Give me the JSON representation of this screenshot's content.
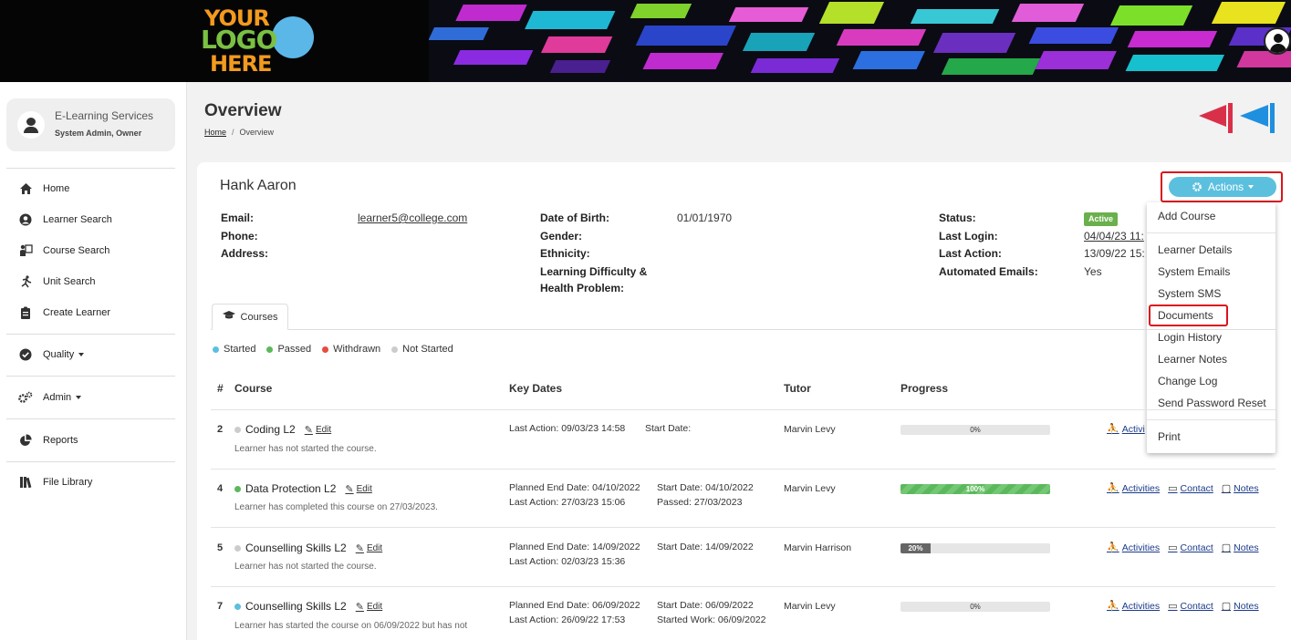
{
  "logo": {
    "line1": "YOUR",
    "line2": "LOGO",
    "line3": "HERE"
  },
  "sidebar": {
    "user": {
      "name": "E-Learning Services",
      "role": "System Admin, Owner"
    },
    "items": [
      {
        "label": "Home",
        "icon": "home-icon"
      },
      {
        "label": "Learner Search",
        "icon": "user-circle-icon"
      },
      {
        "label": "Course Search",
        "icon": "chalkboard-icon"
      },
      {
        "label": "Unit Search",
        "icon": "running-icon"
      },
      {
        "label": "Create Learner",
        "icon": "clipboard-icon"
      },
      {
        "label": "Quality",
        "icon": "check-circle-icon"
      },
      {
        "label": "Admin",
        "icon": "cogs-icon"
      },
      {
        "label": "Reports",
        "icon": "pie-chart-icon"
      },
      {
        "label": "File Library",
        "icon": "books-icon"
      }
    ]
  },
  "page": {
    "title": "Overview",
    "breadcrumb": {
      "home": "Home",
      "sep": "/",
      "current": "Overview"
    }
  },
  "learner": {
    "name": "Hank Aaron",
    "labels": {
      "email": "Email:",
      "phone": "Phone:",
      "address": "Address:",
      "dob": "Date of Birth:",
      "gender": "Gender:",
      "ethnicity": "Ethnicity:",
      "ldhp1": "Learning Difficulty &",
      "ldhp2": "Health Problem:",
      "status": "Status:",
      "last_login": "Last Login:",
      "last_action": "Last Action:",
      "auto_emails": "Automated Emails:"
    },
    "email": "learner5@college.com",
    "dob": "01/01/1970",
    "status": "Active",
    "last_login": "04/04/23 11:",
    "last_action": "13/09/22 15:",
    "auto_emails": "Yes"
  },
  "actions": {
    "label": "Actions",
    "menu": [
      "Add Course",
      "Learner Details",
      "System Emails",
      "System SMS",
      "Documents",
      "Login History",
      "Learner Notes",
      "Change Log",
      "Send Password Reset",
      "Print"
    ]
  },
  "tabs": {
    "courses": "Courses"
  },
  "legend": [
    {
      "label": "Started",
      "color": "#5bc0de"
    },
    {
      "label": "Passed",
      "color": "#5cb85c"
    },
    {
      "label": "Withdrawn",
      "color": "#e74c3c"
    },
    {
      "label": "Not Started",
      "color": "#cccccc"
    }
  ],
  "table": {
    "headers": {
      "num": "#",
      "course": "Course",
      "key_dates": "Key Dates",
      "tutor": "Tutor",
      "progress": "Progress"
    },
    "edit_label": "Edit",
    "links": {
      "activities": "Activities",
      "contact": "Contact",
      "notes": "Notes"
    },
    "rows": [
      {
        "num": "2",
        "course": "Coding L2",
        "status_color": "#cccccc",
        "sub": "Learner has not started the course.",
        "kd1a": "Last Action: 09/03/23 14:58",
        "kd1b": "",
        "kd2a": "Start Date:",
        "kd2b": "",
        "tutor": "Marvin Levy",
        "progress": 0,
        "progress_label": "0%",
        "activities": "Activi"
      },
      {
        "num": "4",
        "course": "Data Protection L2",
        "status_color": "#5cb85c",
        "sub": "Learner has completed this course on 27/03/2023.",
        "kd1a": "Planned End Date: 04/10/2022",
        "kd1b": "Last Action: 27/03/23 15:06",
        "kd2a": "Start Date: 04/10/2022",
        "kd2b": "Passed: 27/03/2023",
        "tutor": "Marvin Levy",
        "progress": 100,
        "progress_label": "100%",
        "activities": "Activities"
      },
      {
        "num": "5",
        "course": "Counselling Skills L2",
        "status_color": "#cccccc",
        "sub": "Learner has not started the course.",
        "kd1a": "Planned End Date: 14/09/2022",
        "kd1b": "Last Action: 02/03/23 15:36",
        "kd2a": "Start Date: 14/09/2022",
        "kd2b": "",
        "tutor": "Marvin Harrison",
        "progress": 20,
        "progress_label": "20%",
        "activities": "Activities"
      },
      {
        "num": "7",
        "course": "Counselling Skills L2",
        "status_color": "#5bc0de",
        "sub": "Learner has started the course on 06/09/2022 but has not",
        "kd1a": "Planned End Date: 06/09/2022",
        "kd1b": "Last Action: 26/09/22 17:53",
        "kd2a": "Start Date: 06/09/2022",
        "kd2b": "Started Work: 06/09/2022",
        "tutor": "Marvin Levy",
        "progress": 0,
        "progress_label": "0%",
        "activities": "Activities"
      }
    ]
  }
}
